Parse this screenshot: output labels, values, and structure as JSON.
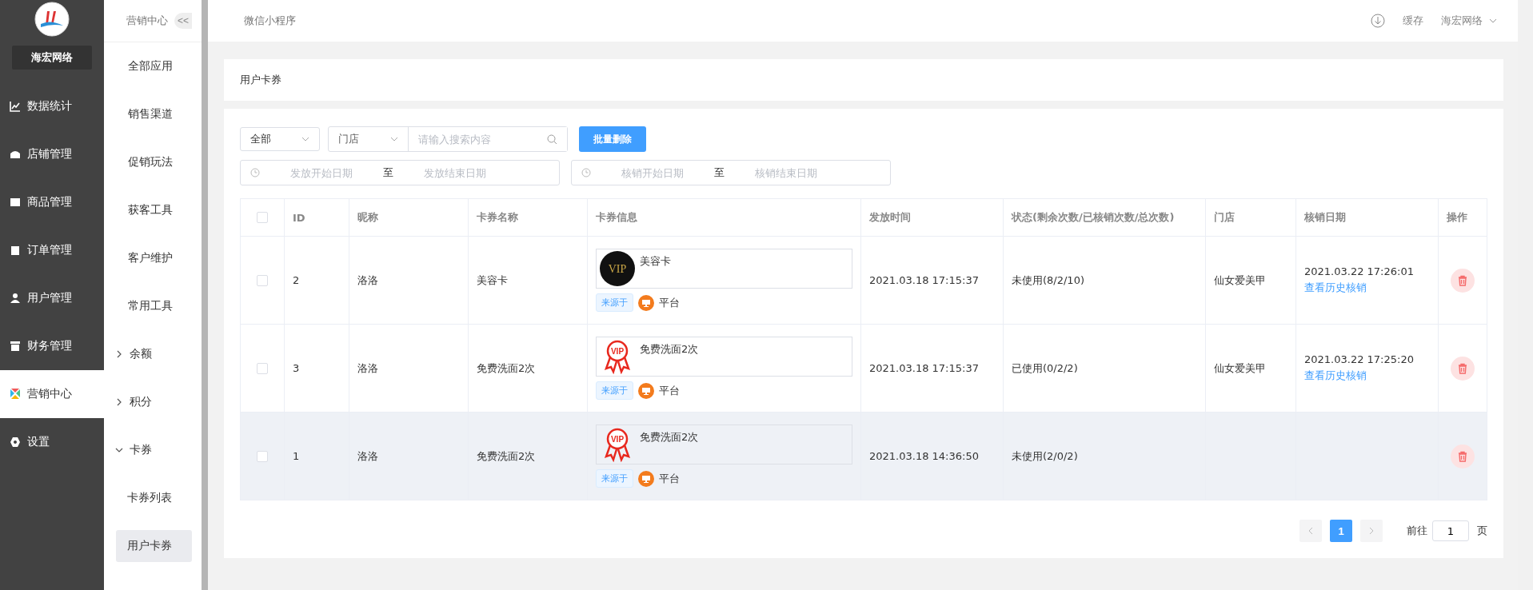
{
  "brand": {
    "name": "海宏网络"
  },
  "nav": [
    {
      "label": "数据统计",
      "selected": false
    },
    {
      "label": "店铺管理",
      "selected": false
    },
    {
      "label": "商品管理",
      "selected": false
    },
    {
      "label": "订单管理",
      "selected": false
    },
    {
      "label": "用户管理",
      "selected": false
    },
    {
      "label": "财务管理",
      "selected": false
    },
    {
      "label": "营销中心",
      "selected": true
    },
    {
      "label": "设置",
      "selected": false
    }
  ],
  "subnav": {
    "title": "营销中心",
    "collapse": "<<",
    "items": [
      {
        "kind": "link",
        "label": "全部应用",
        "selected": false
      },
      {
        "kind": "link",
        "label": "销售渠道",
        "selected": false
      },
      {
        "kind": "link",
        "label": "促销玩法",
        "selected": false
      },
      {
        "kind": "link",
        "label": "获客工具",
        "selected": false
      },
      {
        "kind": "link",
        "label": "客户维护",
        "selected": false
      },
      {
        "kind": "link",
        "label": "常用工具",
        "selected": false
      },
      {
        "kind": "group",
        "label": "余额",
        "expanded": false
      },
      {
        "kind": "group",
        "label": "积分",
        "expanded": false
      },
      {
        "kind": "group",
        "label": "卡券",
        "expanded": true,
        "children": [
          {
            "label": "卡券列表",
            "selected": false
          },
          {
            "label": "用户卡券",
            "selected": true
          }
        ]
      }
    ]
  },
  "topbar": {
    "title": "微信小程序",
    "cache": "缓存",
    "account": "海宏网络"
  },
  "page_title": "用户卡券",
  "filters": {
    "type_select": "全部",
    "store_select": "门店",
    "search": {
      "placeholder": "请输入搜索内容"
    },
    "batch_delete": "批量删除",
    "issue_range": {
      "start_placeholder": "发放开始日期",
      "separator": "至",
      "end_placeholder": "发放结束日期"
    },
    "verify_range": {
      "start_placeholder": "核销开始日期",
      "separator": "至",
      "end_placeholder": "核销结束日期"
    }
  },
  "table": {
    "select_all_checked": false,
    "columns": [
      "ID",
      "昵称",
      "卡券名称",
      "卡券信息",
      "发放时间",
      "状态(剩余次数/已核销次数/总次数)",
      "门店",
      "核销日期",
      "操作"
    ],
    "rows": [
      {
        "checked": false,
        "hovered": false,
        "id": "2",
        "nickname": "洛洛",
        "card_name": "美容卡",
        "info": {
          "kind": "vip-black",
          "badge_text": "VIP",
          "name": "美容卡",
          "source_tag": "来源于",
          "source": "平台"
        },
        "issued": "2021.03.18 17:15:37",
        "status": "未使用(8/2/10)",
        "store": "仙女爱美甲",
        "verified": "2021.03.22 17:26:01",
        "history_link": "查看历史核销"
      },
      {
        "checked": false,
        "hovered": false,
        "id": "3",
        "nickname": "洛洛",
        "card_name": "免费洗面2次",
        "info": {
          "kind": "vip-ribbon",
          "badge_text": "VIP",
          "name": "免费洗面2次",
          "source_tag": "来源于",
          "source": "平台"
        },
        "issued": "2021.03.18 17:15:37",
        "status": "已使用(0/2/2)",
        "store": "仙女爱美甲",
        "verified": "2021.03.22 17:25:20",
        "history_link": "查看历史核销"
      },
      {
        "checked": false,
        "hovered": true,
        "id": "1",
        "nickname": "洛洛",
        "card_name": "免费洗面2次",
        "info": {
          "kind": "vip-ribbon",
          "badge_text": "VIP",
          "name": "免费洗面2次",
          "source_tag": "来源于",
          "source": "平台"
        },
        "issued": "2021.03.18 14:36:50",
        "status": "未使用(2/0/2)"
      }
    ]
  },
  "pagination": {
    "pages": [
      {
        "label": "1",
        "selected": true
      }
    ],
    "goto_label": "前往",
    "goto_value": "1",
    "page_suffix": "页"
  }
}
